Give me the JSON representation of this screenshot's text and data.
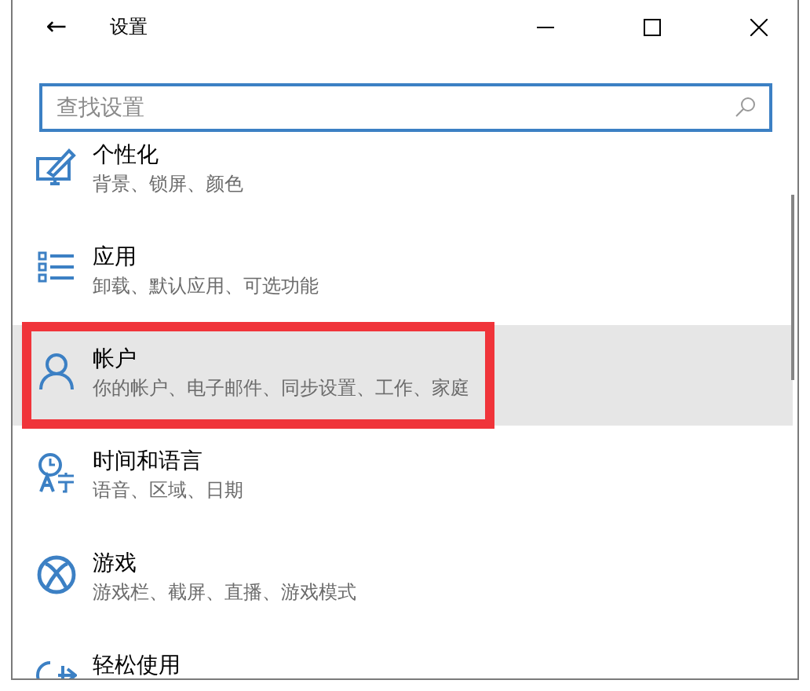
{
  "window": {
    "title": "设置",
    "back": "←"
  },
  "search": {
    "placeholder": "查找设置"
  },
  "items": [
    {
      "kind": "brush",
      "title": "个性化",
      "subtitle": "背景、锁屏、颜色",
      "hovered": false,
      "highlighted": false
    },
    {
      "kind": "list",
      "title": "应用",
      "subtitle": "卸载、默认应用、可选功能",
      "hovered": false,
      "highlighted": false
    },
    {
      "kind": "person",
      "title": "帐户",
      "subtitle": "你的帐户、电子邮件、同步设置、工作、家庭",
      "hovered": true,
      "highlighted": true
    },
    {
      "kind": "time-language",
      "title": "时间和语言",
      "subtitle": "语音、区域、日期",
      "hovered": false,
      "highlighted": false
    },
    {
      "kind": "xbox",
      "title": "游戏",
      "subtitle": "游戏栏、截屏、直播、游戏模式",
      "hovered": false,
      "highlighted": false
    },
    {
      "kind": "ease",
      "title": "轻松使用",
      "hovered": false,
      "highlighted": false
    }
  ]
}
